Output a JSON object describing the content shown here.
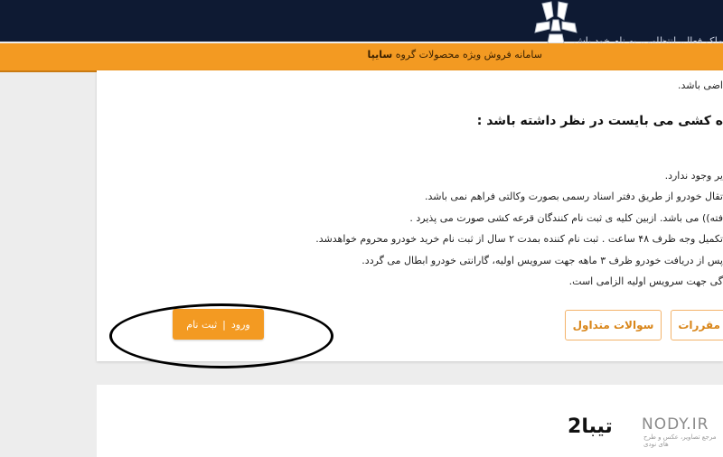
{
  "header": {
    "top_text": "ملک فعال، انتظامی، به نام خود باش",
    "tagline_prefix": "سامانه فروش ویژه محصولات گروه",
    "tagline_brand": "سایپا",
    "logo": "saipa-logo-icon"
  },
  "content": {
    "line_top": "اضی باشد.",
    "heading": "ه کشی می بایست در نظر داشته باشد :",
    "rules": [
      "یر وجود ندارد.",
      "تقال خودرو از طریق دفتر اسناد رسمی بصورت وکالتی فراهم نمی باشد.",
      "فته)) می باشد. ازبین کلیه ی ثبت نام کنندگان قرعه کشی صورت می پذیرد .",
      "تکمیل وجه ظرف ۴۸ ساعت . ثبت نام کننده بمدت ۲ سال از ثبت نام خرید خودرو محروم خواهدشد.",
      "پس از دریافت خودرو ظرف ۳ ماهه جهت سرویس اولیه، گارانتی خودرو ابطال می گردد.",
      "گی جهت سرویس اولیه الزامی است."
    ]
  },
  "buttons": {
    "login": "ورود",
    "separator": "|",
    "register": "ثبت نام",
    "faq": "سوالات متداول",
    "rules_btn": "مقررات"
  },
  "product": {
    "title": "تیبا2"
  },
  "watermark": {
    "text": "NODY.IR",
    "sub": "مرجع تصاویر، عکس و طرح های نودی"
  },
  "colors": {
    "navy": "#0e1a33",
    "orange": "#f39a22"
  }
}
